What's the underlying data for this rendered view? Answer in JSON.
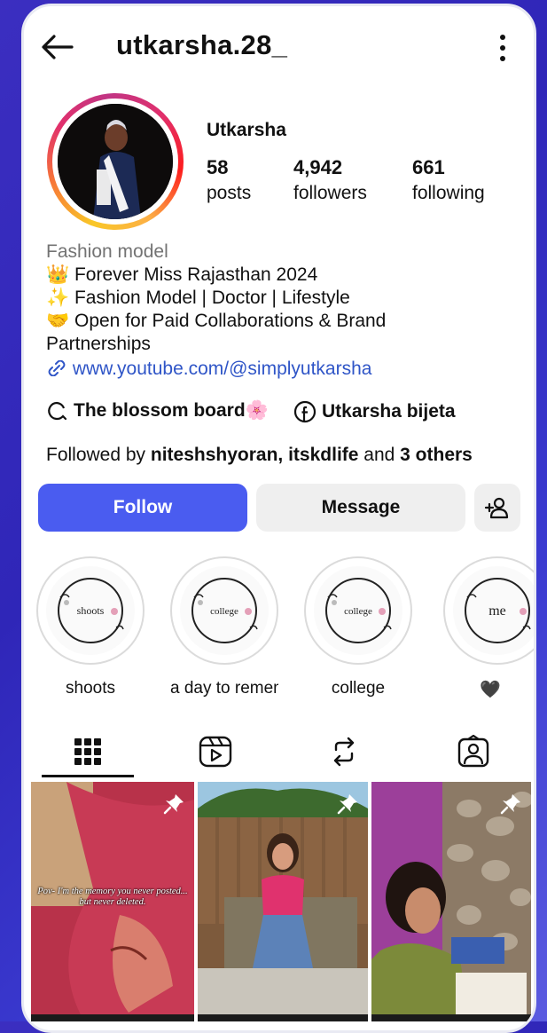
{
  "header": {
    "username": "utkarsha.28_"
  },
  "profile": {
    "display_name": "Utkarsha",
    "stats": [
      {
        "number": "58",
        "label": "posts"
      },
      {
        "number": "4,942",
        "label": "followers"
      },
      {
        "number": "661",
        "label": "following"
      }
    ],
    "category": "Fashion model",
    "bio_lines": [
      "👑 Forever Miss Rajasthan 2024",
      "✨ Fashion Model | Doctor | Lifestyle",
      "🤝 Open for Paid Collaborations & Brand",
      "Partnerships"
    ],
    "link": "www.youtube.com/@simplyutkarsha",
    "threads_chip": "The blossom board🌸",
    "facebook_chip": "Utkarsha bijeta",
    "followed_by": {
      "prefix": "Followed by ",
      "names": "niteshshyoran, itskdlife",
      "middle": " and ",
      "others": "3 others"
    }
  },
  "buttons": {
    "follow": "Follow",
    "message": "Message"
  },
  "highlights": [
    {
      "cover_text": "shoots",
      "label": "shoots"
    },
    {
      "cover_text": "college",
      "label": "a day to remem"
    },
    {
      "cover_text": "college",
      "label": "college"
    },
    {
      "cover_text": "me",
      "label": "🖤"
    }
  ],
  "tabs": [
    "grid-icon",
    "reels-icon",
    "repost-icon",
    "tagged-icon"
  ],
  "posts": [
    {
      "caption": "Pov- I'm the memory you never posted... but never deleted.",
      "pinned": true
    },
    {
      "caption": "",
      "pinned": true
    },
    {
      "caption": "",
      "pinned": true
    }
  ],
  "colors": {
    "follow_button": "#4a5cf0",
    "link": "#2f55c7",
    "category": "#737373",
    "background": "#3b2ec0"
  }
}
